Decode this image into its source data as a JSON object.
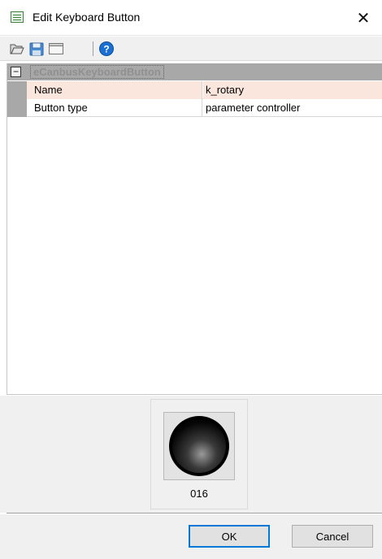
{
  "window": {
    "title": "Edit Keyboard Button",
    "close_glyph": "✕",
    "icon": "dialog-icon"
  },
  "toolbar": {
    "buttons": [
      {
        "name": "open-icon",
        "tooltip": ""
      },
      {
        "name": "save-icon",
        "tooltip": ""
      },
      {
        "name": "window-icon",
        "tooltip": ""
      },
      {
        "name": "help-icon",
        "tooltip": ""
      }
    ]
  },
  "property_grid": {
    "category": {
      "label": "eCanbusKeyboardButton",
      "toggle": "−"
    },
    "rows": [
      {
        "name": "Name",
        "value": "k_rotary",
        "selected": true
      },
      {
        "name": "Button type",
        "value": "parameter controller",
        "selected": false
      }
    ]
  },
  "preview": {
    "caption": "016"
  },
  "buttons": {
    "ok": "OK",
    "cancel": "Cancel"
  },
  "colors": {
    "selected_row": "#fbe6dd",
    "category_bg": "#a8a8a8",
    "ok_border": "#0078d7",
    "help_blue": "#1b6fd0"
  }
}
